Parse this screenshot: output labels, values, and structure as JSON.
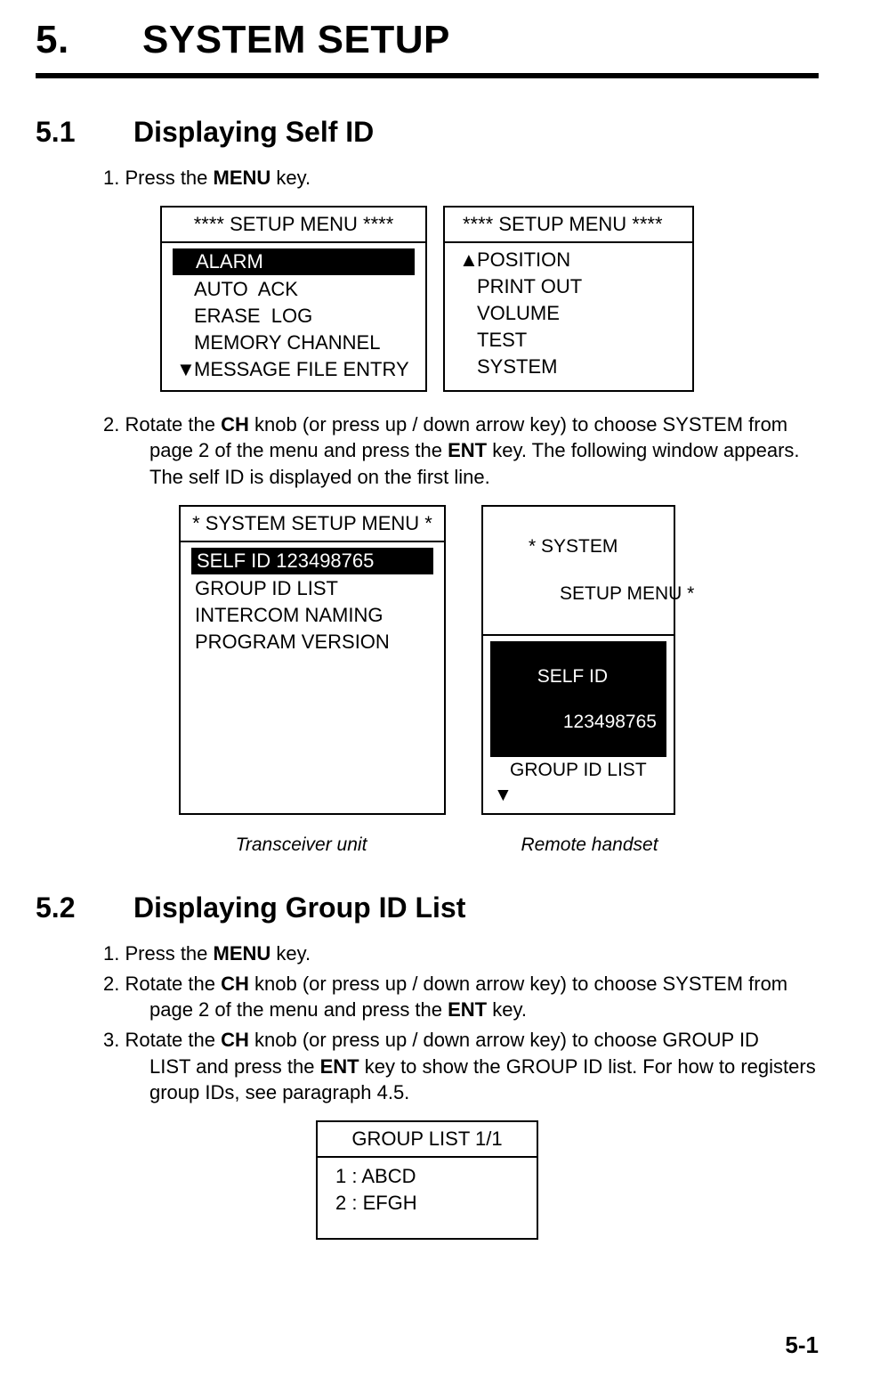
{
  "chapter": {
    "num": "5.",
    "title": "SYSTEM SETUP"
  },
  "section51": {
    "num": "5.1",
    "title": "Displaying Self ID",
    "step1": {
      "num": "1. ",
      "text_pre": "Press the ",
      "bold1": "MENU",
      "text_post": " key."
    },
    "step2": {
      "num": "2. ",
      "pre": "Rotate the ",
      "b1": "CH",
      "mid1": " knob (or press up / down arrow key) to choose SYSTEM from",
      "line2a": "page 2 of the menu and press the ",
      "b2": "ENT",
      "line2b": " key. The following window appears.",
      "line3": "The self ID is displayed on the first line."
    },
    "setup1": {
      "title": "**** SETUP MENU ****",
      "items": [
        "ALARM",
        "AUTO  ACK",
        "ERASE  LOG",
        "MEMORY CHANNEL",
        "MESSAGE FILE ENTRY"
      ],
      "down": "▼"
    },
    "setup2": {
      "title": "**** SETUP MENU ****",
      "items": [
        "POSITION",
        "PRINT OUT",
        "VOLUME",
        "TEST",
        "SYSTEM"
      ],
      "up": "▲"
    },
    "syssetup": {
      "title": "* SYSTEM SETUP MENU *",
      "highlight": "SELF ID 123498765",
      "items": [
        "GROUP ID LIST",
        "INTERCOM NAMING",
        "PROGRAM VERSION"
      ]
    },
    "remote": {
      "title_l1": "* SYSTEM",
      "title_l2": "      SETUP MENU *",
      "hl_l1": "SELF ID",
      "hl_l2": "     123498765",
      "item": "GROUP ID LIST",
      "down": "▼"
    },
    "caption1": "Transceiver unit",
    "caption2": "Remote handset"
  },
  "section52": {
    "num": "5.2",
    "title": "Displaying Group ID List",
    "step1": {
      "num": "1. ",
      "pre": "Press the ",
      "b1": "MENU",
      "post": " key."
    },
    "step2": {
      "num": "2. ",
      "pre": "Rotate the ",
      "b1": "CH",
      "mid": " knob (or press up / down arrow key) to choose SYSTEM from",
      "line2a": "page 2 of the menu and press the ",
      "b2": "ENT",
      "line2b": " key."
    },
    "step3": {
      "num": "3. ",
      "pre": "Rotate the ",
      "b1": "CH",
      "mid": " knob (or press up / down arrow key) to choose GROUP ID",
      "line2a": "LIST and press the ",
      "b2": "ENT",
      "line2b": " key to show the GROUP ID list. For how to registers",
      "line3": "group IDs, see paragraph 4.5."
    },
    "grouplist": {
      "title": "GROUP LIST 1/1",
      "items": [
        "1 : ABCD",
        "2 : EFGH"
      ]
    }
  },
  "page_num": "5-1"
}
